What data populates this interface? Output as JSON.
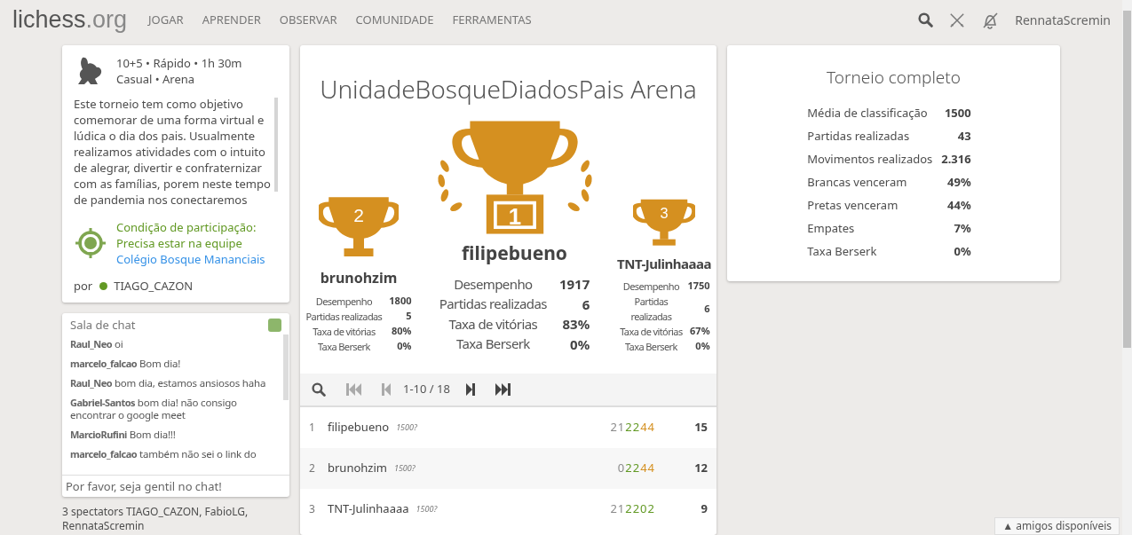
{
  "header": {
    "logo": "lichess",
    "logo_tld": ".org",
    "nav": [
      "JOGAR",
      "APRENDER",
      "OBSERVAR",
      "COMUNIDADE",
      "FERRAMENTAS"
    ],
    "username": "RennataScremin"
  },
  "info": {
    "line1": "10+5 • Rápido • 1h 30m",
    "line2": "Casual • Arena",
    "description": "Este torneio tem como objetivo comemorar de uma forma virtual e lúdica o dia dos pais. Usualmente realizamos atividades com o intuito de alegrar, divertir e confraternizar com as famílias, porem neste tempo de pandemia nos conectaremos",
    "condition_title": "Condição de participação:",
    "condition_text": "Precisa estar na equipe",
    "condition_link": "Colégio Bosque Mananciais",
    "by_label": "por",
    "creator": "TIAGO_CAZON"
  },
  "chat": {
    "title": "Sala de chat",
    "enabled": true,
    "messages": [
      {
        "user": "Raul_Neo",
        "text": "oi"
      },
      {
        "user": "marcelo_falcao",
        "text": "Bom dia!"
      },
      {
        "user": "Raul_Neo",
        "text": "bom dia, estamos ansiosos haha"
      },
      {
        "user": "Gabriel-Santos",
        "text": "bom dia! não consigo encontrar o google meet"
      },
      {
        "user": "MarcioRufini",
        "text": "Bom dia!!!"
      },
      {
        "user": "marcelo_falcao",
        "text": "também não sei o link do"
      }
    ],
    "placeholder": "Por favor, seja gentil no chat!"
  },
  "spectators": "3 spectators TIAGO_CAZON, FabioLG, RennataScremin",
  "tournament": {
    "title": "UnidadeBosqueDiadosPais Arena",
    "podium": [
      {
        "rank": "1",
        "name": "filipebueno",
        "stats": [
          {
            "label": "Desempenho",
            "value": "1917"
          },
          {
            "label": "Partidas realizadas",
            "value": "6"
          },
          {
            "label": "Taxa de vitórias",
            "value": "83%"
          },
          {
            "label": "Taxa Berserk",
            "value": "0%"
          }
        ]
      },
      {
        "rank": "2",
        "name": "brunohzim",
        "stats": [
          {
            "label": "Desempenho",
            "value": "1800"
          },
          {
            "label": "Partidas realizadas",
            "value": "5"
          },
          {
            "label": "Taxa de vitórias",
            "value": "80%"
          },
          {
            "label": "Taxa Berserk",
            "value": "0%"
          }
        ]
      },
      {
        "rank": "3",
        "name": "TNT-Julinhaaaa",
        "stats": [
          {
            "label": "Desempenho",
            "value": "1750"
          },
          {
            "label": "Partidas realizadas",
            "value": "6"
          },
          {
            "label": "Taxa de vitórias",
            "value": "67%"
          },
          {
            "label": "Taxa Berserk",
            "value": "0%"
          }
        ]
      }
    ],
    "pager": "1-10 / 18",
    "standings": [
      {
        "rank": "1",
        "name": "filipebueno",
        "rating": "1500?",
        "sheet": [
          {
            "digits": "21",
            "color": "#8a8a8a"
          },
          {
            "digits": "22",
            "color": "#629924"
          },
          {
            "digits": "44",
            "color": "#d59020"
          }
        ],
        "score": "15"
      },
      {
        "rank": "2",
        "name": "brunohzim",
        "rating": "1500?",
        "sheet": [
          {
            "digits": "0",
            "color": "#8a8a8a"
          },
          {
            "digits": "22",
            "color": "#629924"
          },
          {
            "digits": "44",
            "color": "#d59020"
          }
        ],
        "score": "12"
      },
      {
        "rank": "3",
        "name": "TNT-Julinhaaaa",
        "rating": "1500?",
        "sheet": [
          {
            "digits": "21",
            "color": "#8a8a8a"
          },
          {
            "digits": "2202",
            "color": "#629924"
          }
        ],
        "score": "9"
      }
    ]
  },
  "summary": {
    "title": "Torneio completo",
    "stats": [
      [
        "Média de classificação",
        "1500"
      ],
      [
        "Partidas realizadas",
        "43"
      ],
      [
        "Movimentos realizados",
        "2.316"
      ],
      [
        "Brancas venceram",
        "49%"
      ],
      [
        "Pretas venceram",
        "44%"
      ],
      [
        "Empates",
        "7%"
      ],
      [
        "Taxa Berserk",
        "0%"
      ]
    ]
  },
  "friends": "▲ amigos disponíveis"
}
